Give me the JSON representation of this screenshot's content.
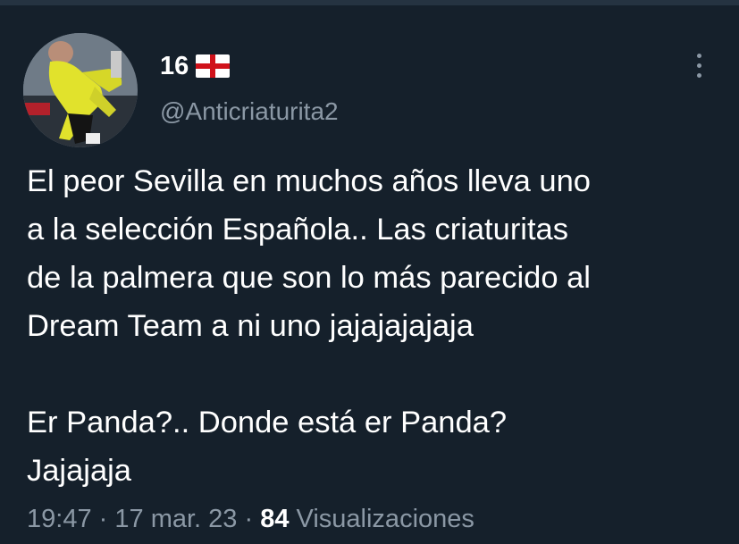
{
  "colors": {
    "background": "#15202b",
    "text": "#ffffff",
    "muted": "#8b98a5"
  },
  "author": {
    "display_name": "16",
    "flag_icon": "england-flag-icon",
    "handle": "@Anticriaturita2",
    "avatar_icon": "profile-avatar"
  },
  "menu": {
    "icon": "more-vertical-icon"
  },
  "tweet": {
    "lines": [
      "El peor Sevilla en muchos años lleva uno",
      "a la selección Española.. Las criaturitas",
      "de la palmera que son lo más parecido al",
      "Dream Team a ni uno jajajajajaja"
    ],
    "lines2": [
      "Er Panda?.. Donde está er Panda?",
      "Jajajaja"
    ]
  },
  "meta": {
    "time": "19:47",
    "separator": "·",
    "date": "17 mar. 23",
    "views_count": "84",
    "views_label": "Visualizaciones"
  }
}
